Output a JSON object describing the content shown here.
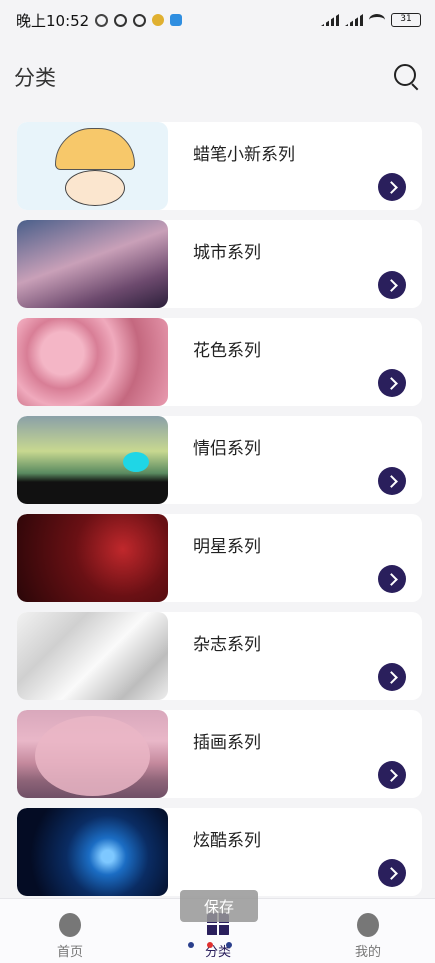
{
  "status_bar": {
    "time": "晚上10:52",
    "battery": "31"
  },
  "header": {
    "title": "分类",
    "search_icon": "search-icon"
  },
  "categories": [
    {
      "label": "蜡笔小新系列"
    },
    {
      "label": "城市系列"
    },
    {
      "label": "花色系列"
    },
    {
      "label": "情侣系列"
    },
    {
      "label": "明星系列"
    },
    {
      "label": "杂志系列"
    },
    {
      "label": "插画系列"
    },
    {
      "label": "炫酷系列"
    }
  ],
  "toast": "保存",
  "bottom_nav": {
    "home": "首页",
    "category": "分类",
    "mine": "我的"
  },
  "colors": {
    "accent": "#2a1f5c",
    "background": "#f4f4f6"
  }
}
